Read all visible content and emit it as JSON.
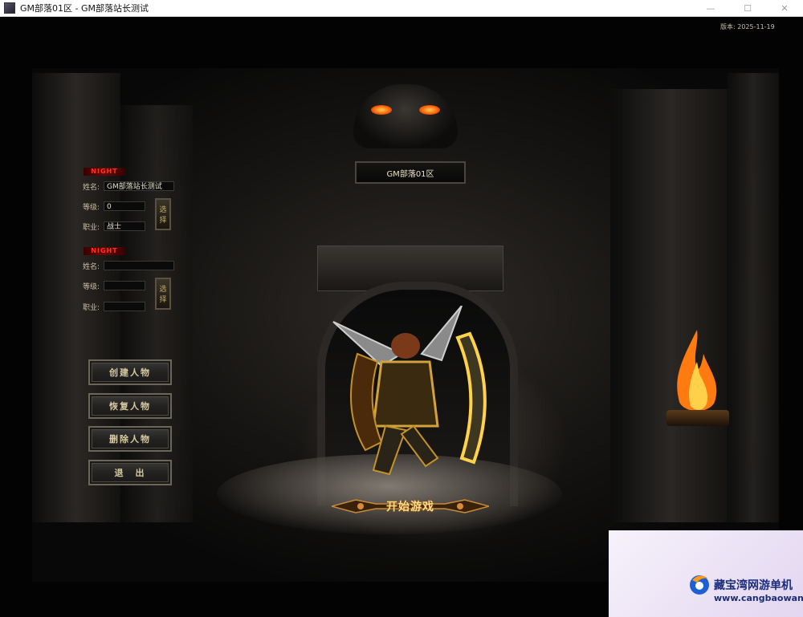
{
  "window": {
    "title": "GM部落01区 - GM部落站长测试",
    "controls": {
      "minimize": "—",
      "maximize": "☐",
      "close": "✕"
    }
  },
  "game": {
    "version": "版本: 2025-11-19",
    "server_name": "GM部落01区",
    "slots": [
      {
        "title": "NIGHT",
        "name_label": "姓名:",
        "name_value": "GM部落站长测试",
        "level_label": "等级:",
        "level_value": "0",
        "class_label": "职业:",
        "class_value": "战士",
        "select_label": [
          "选",
          "择"
        ]
      },
      {
        "title": "NIGHT",
        "name_label": "姓名:",
        "name_value": "",
        "level_label": "等级:",
        "level_value": "",
        "class_label": "职业:",
        "class_value": "",
        "select_label": [
          "选",
          "择"
        ]
      }
    ],
    "menu": {
      "create": "创建人物",
      "restore": "恢复人物",
      "delete": "删除人物",
      "exit": "退　出"
    },
    "start_game": "开始游戏"
  },
  "watermark": {
    "name": "藏宝湾网游单机",
    "url": "www.cangbaowan.net"
  }
}
